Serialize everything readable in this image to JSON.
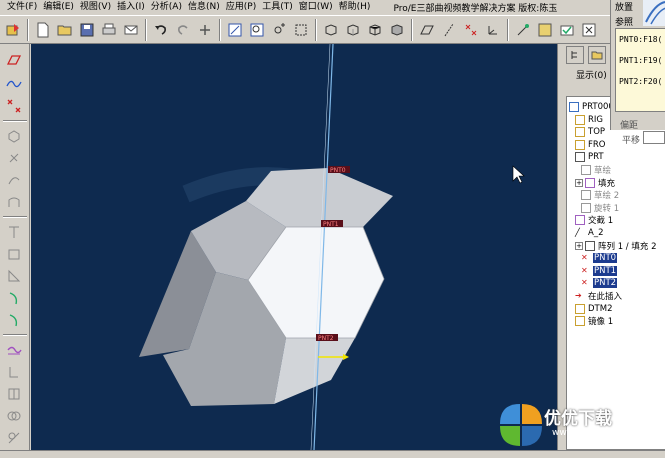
{
  "menubar": {
    "items": [
      "文件(F)",
      "编辑(E)",
      "视图(V)",
      "插入(I)",
      "分析(A)",
      "信息(N)",
      "应用(P)",
      "工具(T)",
      "窗口(W)",
      "帮助(H)"
    ],
    "window_title": "Pro/E三部曲视频教学解决方案  版权:陈玉"
  },
  "dialog": {
    "tab_placement": "放置",
    "tab_references": "参照",
    "references": [
      "PNT0:F18(",
      "PNT1:F19(",
      "PNT2:F20("
    ],
    "offset_label": "偏距",
    "translate_label": "平移"
  },
  "rightpanel": {
    "show_label": "显示(0)"
  },
  "tree": {
    "items": [
      {
        "label": "PRT000",
        "state": "normal",
        "icon": "part-icon"
      },
      {
        "label": "RIG",
        "state": "normal",
        "icon": "datum-plane-icon"
      },
      {
        "label": "TOP",
        "state": "normal",
        "icon": "datum-plane-icon"
      },
      {
        "label": "FRO",
        "state": "normal",
        "icon": "datum-plane-icon"
      },
      {
        "label": "PRT",
        "state": "normal",
        "icon": "csys-icon"
      },
      {
        "label": "草绘",
        "state": "dim",
        "icon": "sketch-icon"
      },
      {
        "label": "填充",
        "state": "normal",
        "icon": "fill-icon"
      },
      {
        "label": "草绘 2",
        "state": "dim",
        "icon": "sketch-icon"
      },
      {
        "label": "旋转 1",
        "state": "dim",
        "icon": "revolve-icon"
      },
      {
        "label": "交截 1",
        "state": "normal",
        "icon": "intersect-icon"
      },
      {
        "label": "A_2",
        "state": "normal",
        "icon": "axis-icon"
      },
      {
        "label": "阵列 1 / 填充 2",
        "state": "normal",
        "icon": "pattern-icon"
      },
      {
        "label": "PNT0",
        "state": "selected",
        "icon": "datum-point-icon"
      },
      {
        "label": "PNT1",
        "state": "selected",
        "icon": "datum-point-icon"
      },
      {
        "label": "PNT2",
        "state": "selected",
        "icon": "datum-point-icon"
      },
      {
        "label": "在此插入",
        "state": "normal",
        "icon": "insert-arrow-icon"
      },
      {
        "label": "DTM2",
        "state": "normal",
        "icon": "datum-plane-icon"
      },
      {
        "label": "镜像 1",
        "state": "normal",
        "icon": "mirror-icon"
      }
    ]
  },
  "viewport": {
    "point_labels": [
      "PNT0",
      "PNT1",
      "PNT2"
    ]
  },
  "watermark": {
    "text": "优优下载",
    "url": "www.yyxt.com"
  },
  "colors": {
    "viewport_bg": "#0e2a4f",
    "selection": "#1c3b8f",
    "axis": "#7fb8e8",
    "arrow": "#f2e600"
  }
}
